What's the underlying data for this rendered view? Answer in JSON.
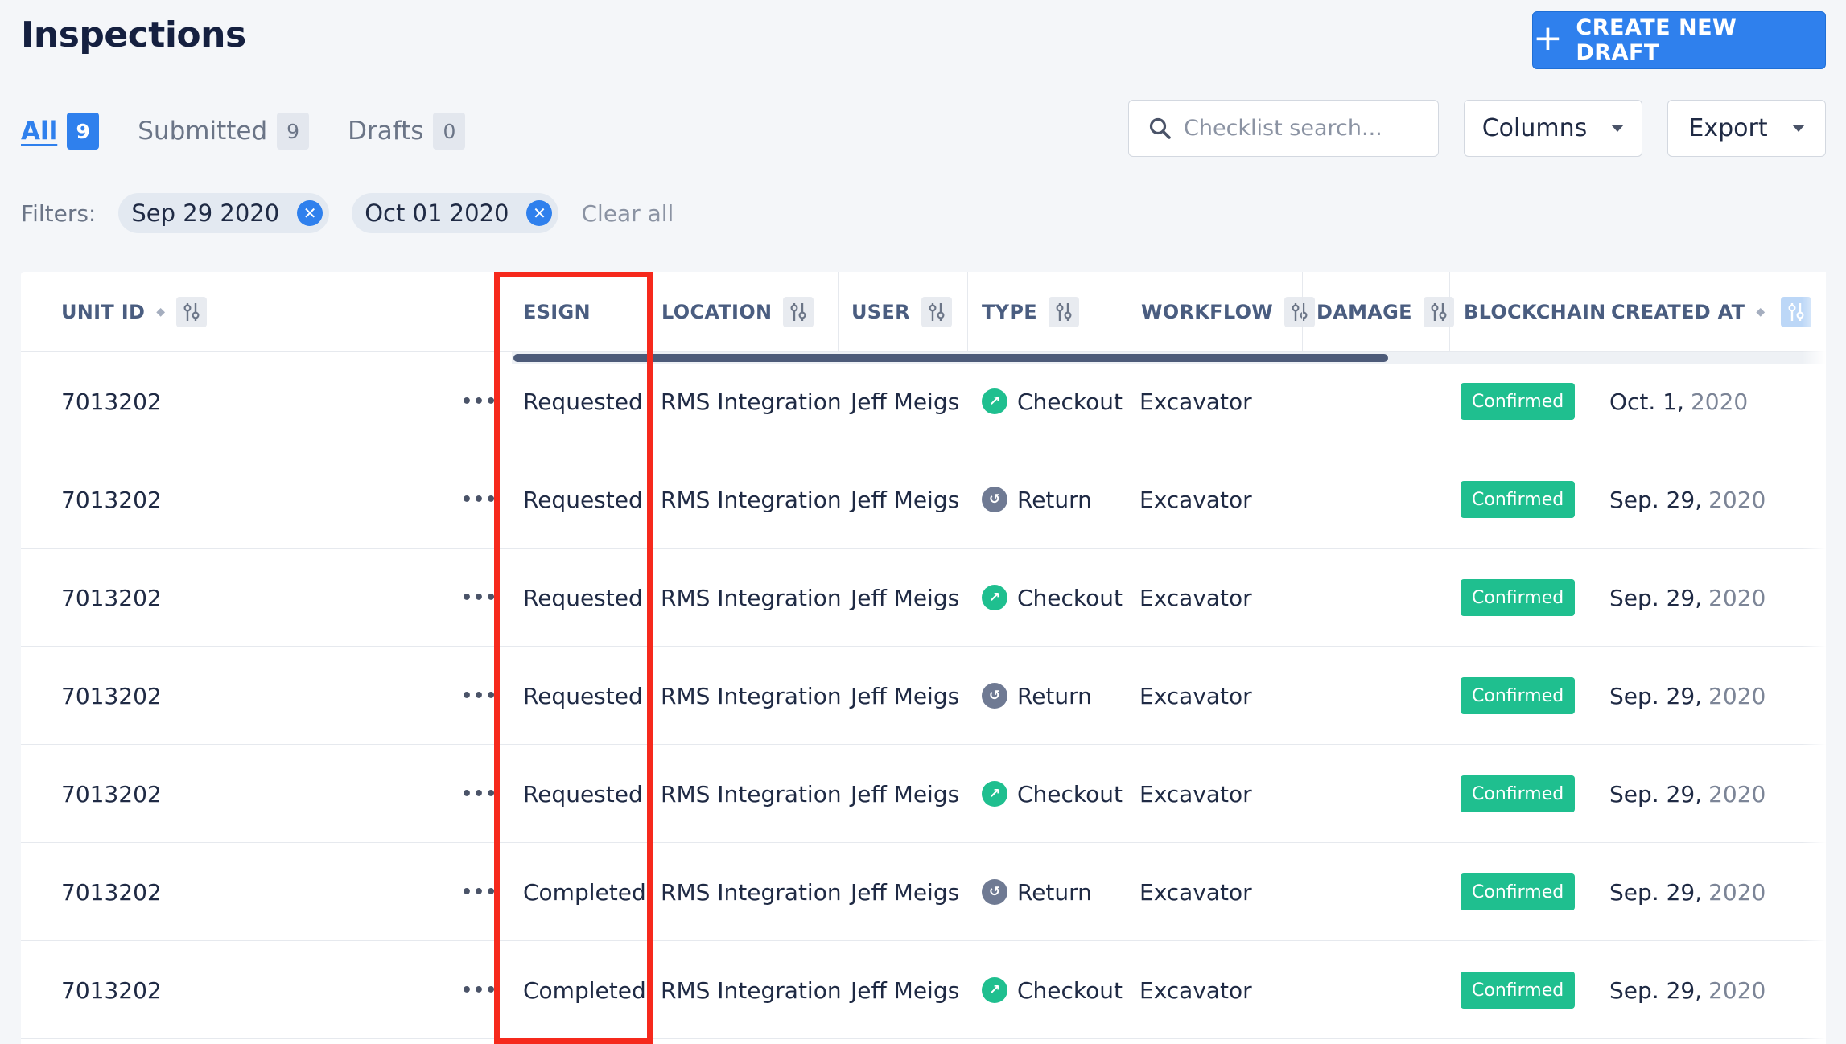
{
  "page": {
    "title": "Inspections"
  },
  "actions": {
    "create_label": "CREATE NEW DRAFT"
  },
  "tabs": [
    {
      "label": "All",
      "count": "9",
      "active": true
    },
    {
      "label": "Submitted",
      "count": "9",
      "active": false
    },
    {
      "label": "Drafts",
      "count": "0",
      "active": false
    }
  ],
  "search": {
    "placeholder": "Checklist search..."
  },
  "columns_button": {
    "label": "Columns"
  },
  "export_button": {
    "label": "Export"
  },
  "filters": {
    "label": "Filters:",
    "chips": [
      "Sep 29 2020",
      "Oct 01 2020"
    ],
    "clear_label": "Clear all"
  },
  "table": {
    "headers": {
      "unit_id": "UNIT ID",
      "esign": "ESIGN",
      "location": "LOCATION",
      "user": "USER",
      "type": "TYPE",
      "workflow": "WORKFLOW",
      "damage": "DAMAGE",
      "blockchain": "BLOCKCHAIN",
      "created_at": "CREATED AT"
    },
    "rows": [
      {
        "unit_id": "7013202",
        "esign": "Requested",
        "location": "RMS Integration",
        "user": "Jeff Meigs",
        "type": "Checkout",
        "type_icon": "checkout-arrow-icon",
        "workflow": "Excavator",
        "damage": "",
        "blockchain": "Confirmed",
        "created_md": "Oct. 1,",
        "created_year": "2020"
      },
      {
        "unit_id": "7013202",
        "esign": "Requested",
        "location": "RMS Integration",
        "user": "Jeff Meigs",
        "type": "Return",
        "type_icon": "return-arrow-icon",
        "workflow": "Excavator",
        "damage": "",
        "blockchain": "Confirmed",
        "created_md": "Sep. 29,",
        "created_year": "2020"
      },
      {
        "unit_id": "7013202",
        "esign": "Requested",
        "location": "RMS Integration",
        "user": "Jeff Meigs",
        "type": "Checkout",
        "type_icon": "checkout-arrow-icon",
        "workflow": "Excavator",
        "damage": "",
        "blockchain": "Confirmed",
        "created_md": "Sep. 29,",
        "created_year": "2020"
      },
      {
        "unit_id": "7013202",
        "esign": "Requested",
        "location": "RMS Integration",
        "user": "Jeff Meigs",
        "type": "Return",
        "type_icon": "return-arrow-icon",
        "workflow": "Excavator",
        "damage": "",
        "blockchain": "Confirmed",
        "created_md": "Sep. 29,",
        "created_year": "2020"
      },
      {
        "unit_id": "7013202",
        "esign": "Requested",
        "location": "RMS Integration",
        "user": "Jeff Meigs",
        "type": "Checkout",
        "type_icon": "checkout-arrow-icon",
        "workflow": "Excavator",
        "damage": "",
        "blockchain": "Confirmed",
        "created_md": "Sep. 29,",
        "created_year": "2020"
      },
      {
        "unit_id": "7013202",
        "esign": "Completed",
        "location": "RMS Integration",
        "user": "Jeff Meigs",
        "type": "Return",
        "type_icon": "return-arrow-icon",
        "workflow": "Excavator",
        "damage": "",
        "blockchain": "Confirmed",
        "created_md": "Sep. 29,",
        "created_year": "2020"
      },
      {
        "unit_id": "7013202",
        "esign": "Completed",
        "location": "RMS Integration",
        "user": "Jeff Meigs",
        "type": "Checkout",
        "type_icon": "checkout-arrow-icon",
        "workflow": "Excavator",
        "damage": "",
        "blockchain": "Confirmed",
        "created_md": "Sep. 29,",
        "created_year": "2020"
      }
    ]
  },
  "colors": {
    "primary": "#2f80ed",
    "success": "#1fbf8f",
    "highlight": "#f6291c"
  }
}
